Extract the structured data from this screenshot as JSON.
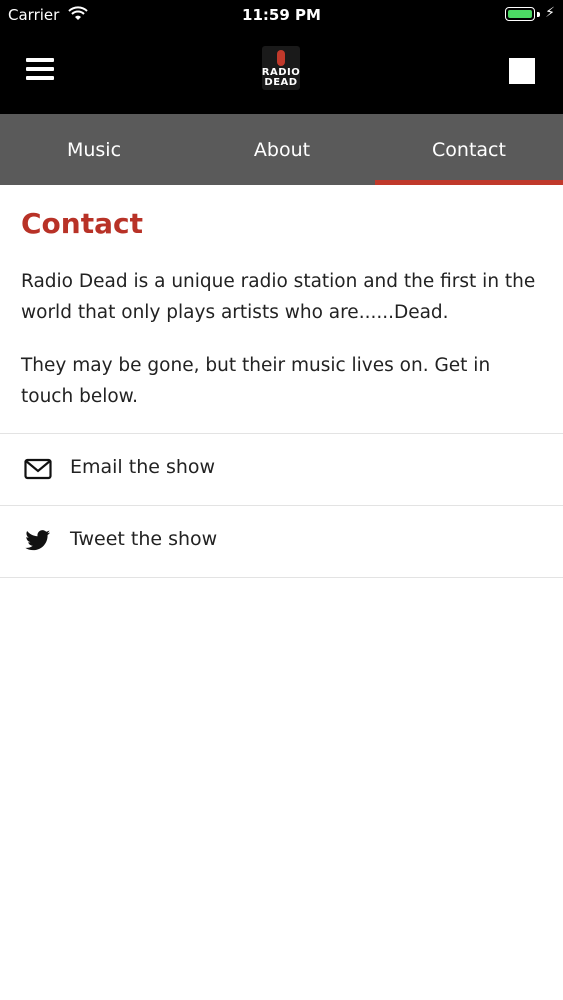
{
  "status_bar": {
    "carrier": "Carrier",
    "time": "11:59 PM",
    "battery_level": 1.0
  },
  "header": {
    "logo_text_line1": "RADIO",
    "logo_text_line2": "DEAD",
    "accent_color": "#c0392b"
  },
  "tabs": [
    {
      "label": "Music",
      "selected": false
    },
    {
      "label": "About",
      "selected": false
    },
    {
      "label": "Contact",
      "selected": true
    }
  ],
  "content": {
    "title": "Contact",
    "paragraph1": "Radio Dead is a unique radio station and the first in the world that only plays artists who are......Dead.",
    "paragraph2": "They may be gone, but their music lives on. Get in touch below."
  },
  "actions": [
    {
      "label": "Email the show",
      "icon": "envelope-icon"
    },
    {
      "label": "Tweet the show",
      "icon": "twitter-icon"
    }
  ]
}
